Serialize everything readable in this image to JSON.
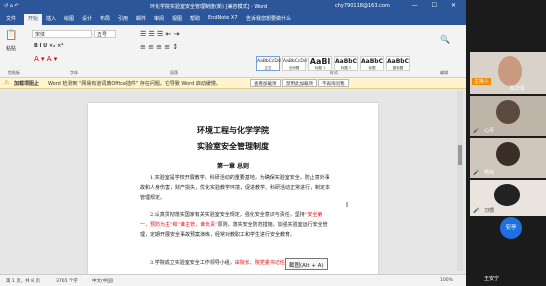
{
  "titlebar": {
    "quick_access": "↺  ⌂  ↶",
    "doc_title": "环化学院实验室安全管理制度(新) [兼容模式] - Word",
    "account": "chy790118@163.com",
    "window_controls": "—  ☐  ✕"
  },
  "tabs": [
    "文件",
    "开始",
    "插入",
    "绘图",
    "设计",
    "布局",
    "引用",
    "邮件",
    "审阅",
    "视图",
    "帮助",
    "EndNote X7",
    "告诉我您想要做什么"
  ],
  "active_tab_index": 1,
  "ribbon": {
    "font_name": "宋体",
    "font_size": "五号",
    "format_buttons": "B  I  U  ×₂  ×²",
    "clipboard_label": "剪贴板",
    "font_label": "字体",
    "paragraph_label": "段落",
    "styles_label": "样式",
    "editing_label": "编辑",
    "paste_label": "粘贴",
    "styles": [
      {
        "sample": "AaBbCcDd",
        "name": "正文"
      },
      {
        "sample": "AaBbCcDd",
        "name": "无间隔"
      },
      {
        "sample": "AaBl",
        "name": "标题 1"
      },
      {
        "sample": "AaBbC",
        "name": "标题 2"
      },
      {
        "sample": "AaBbC",
        "name": "标题"
      },
      {
        "sample": "AaBbC",
        "name": "副标题"
      }
    ]
  },
  "infobar": {
    "label": "加载项阻止",
    "message": "Word 检测到 \"网易有道词典Office插件\" 存在问题。它导致 Word 启动缓慢。",
    "btn1": "查看加载项",
    "btn2": "禁用此加载项",
    "btn3": "不再询问我"
  },
  "document": {
    "title1": "环境工程与化学学院",
    "title2": "实验室安全管理制度",
    "chapter": "第一章  总则",
    "p1": "1.实验室是学校开展教学、科研活动的重要基地，为确保实验室安全，防止意外事故和人身伤害，财产损失，优化实验教学环境，促进教学、科研活动正常进行，制定本管理规定。",
    "p2_prefix": "2.认真贯彻落实国家有关实验室安全规定，强化安全意识与责任，坚持",
    "p2_red": "“安全第一，预防为主”和“谁主管，谁负责”",
    "p2_suffix": "原则，落实安全防范措施，加强实验室运行安全管理，定期开展安全事故预案演练，经常对教职工和学生进行安全教育。",
    "p3_prefix": "3.学院成立实验室安全工作领导小组，",
    "p3_red": "由院长、院党委书记任组长"
  },
  "status": {
    "page": "第 1 页，共 8 页",
    "words": "3765 个字",
    "lang": "中文(中国)",
    "zoom": "100%"
  },
  "tooltip": "截图(Alt + A)",
  "participants": [
    {
      "name": "主持人",
      "label": "陈华军",
      "host": true
    },
    {
      "name": "心月",
      "label": "心月"
    },
    {
      "name": "杨帅",
      "label": "杨帅"
    },
    {
      "name": "习惯",
      "label": "习惯"
    },
    {
      "name": "安亭",
      "label": "安亭"
    },
    {
      "name": "王安宁",
      "label": "王安宁"
    }
  ],
  "colors": {
    "word_blue": "#2b579a",
    "host_orange": "#f08c00",
    "self_avatar": "#1e70e0"
  }
}
